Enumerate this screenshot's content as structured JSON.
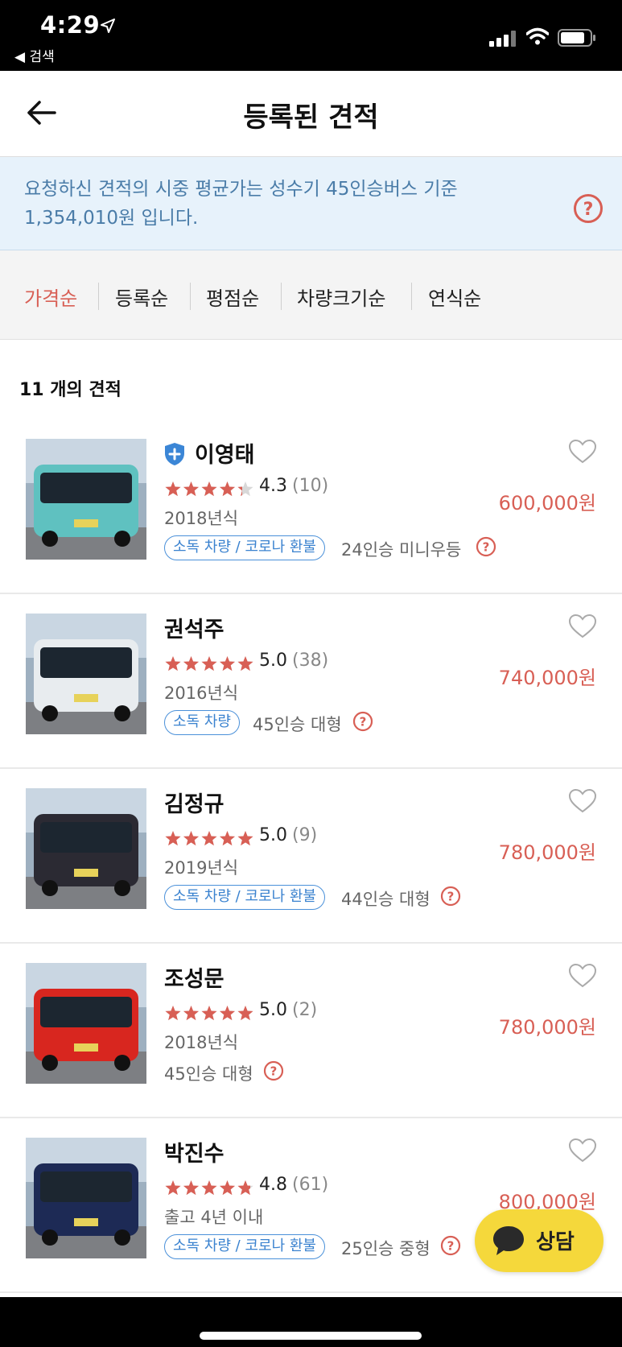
{
  "status_bar": {
    "time": "4:29",
    "back_app": "◀ 검색"
  },
  "header": {
    "title": "등록된 견적"
  },
  "notice": {
    "text": "요청하신 견적의 시중 평균가는 성수기 45인승버스 기준 1,354,010원 입니다."
  },
  "sort": {
    "options": [
      "가격순",
      "등록순",
      "평점순",
      "차량크기순",
      "연식순"
    ],
    "active": "가격순"
  },
  "list": {
    "count_label": "11 개의 견적",
    "quotes": [
      {
        "name": "이영태",
        "verified": true,
        "rating": 4.3,
        "rating_text": "4.3",
        "reviews": "(10)",
        "year": "2018년식",
        "tag": "소독 차량 / 코로나 환불",
        "spec": "24인승 미니우등",
        "price": "600,000원",
        "bus_color": "#5fc1c0"
      },
      {
        "name": "권석주",
        "verified": false,
        "rating": 5.0,
        "rating_text": "5.0",
        "reviews": "(38)",
        "year": "2016년식",
        "tag": "소독 차량",
        "spec": "45인승 대형",
        "price": "740,000원",
        "bus_color": "#e8ecef"
      },
      {
        "name": "김정규",
        "verified": false,
        "rating": 5.0,
        "rating_text": "5.0",
        "reviews": "(9)",
        "year": "2019년식",
        "tag": "소독 차량 / 코로나 환불",
        "spec": "44인승 대형",
        "price": "780,000원",
        "bus_color": "#2b2a33"
      },
      {
        "name": "조성문",
        "verified": false,
        "rating": 5.0,
        "rating_text": "5.0",
        "reviews": "(2)",
        "year": "2018년식",
        "tag": "",
        "spec": "45인승 대형",
        "price": "780,000원",
        "bus_color": "#d8261f"
      },
      {
        "name": "박진수",
        "verified": false,
        "rating": 4.8,
        "rating_text": "4.8",
        "reviews": "(61)",
        "year": "출고 4년 이내",
        "tag": "소독 차량 / 코로나 환불",
        "spec": "25인승 중형",
        "price": "800,000원",
        "bus_color": "#1d2a55"
      }
    ]
  },
  "chat_button": {
    "label": "상담"
  },
  "colors": {
    "accent": "#d85f55",
    "tag_blue": "#3a82cf",
    "fab_yellow": "#f5d83b",
    "notice_bg": "#e7f2fb"
  }
}
